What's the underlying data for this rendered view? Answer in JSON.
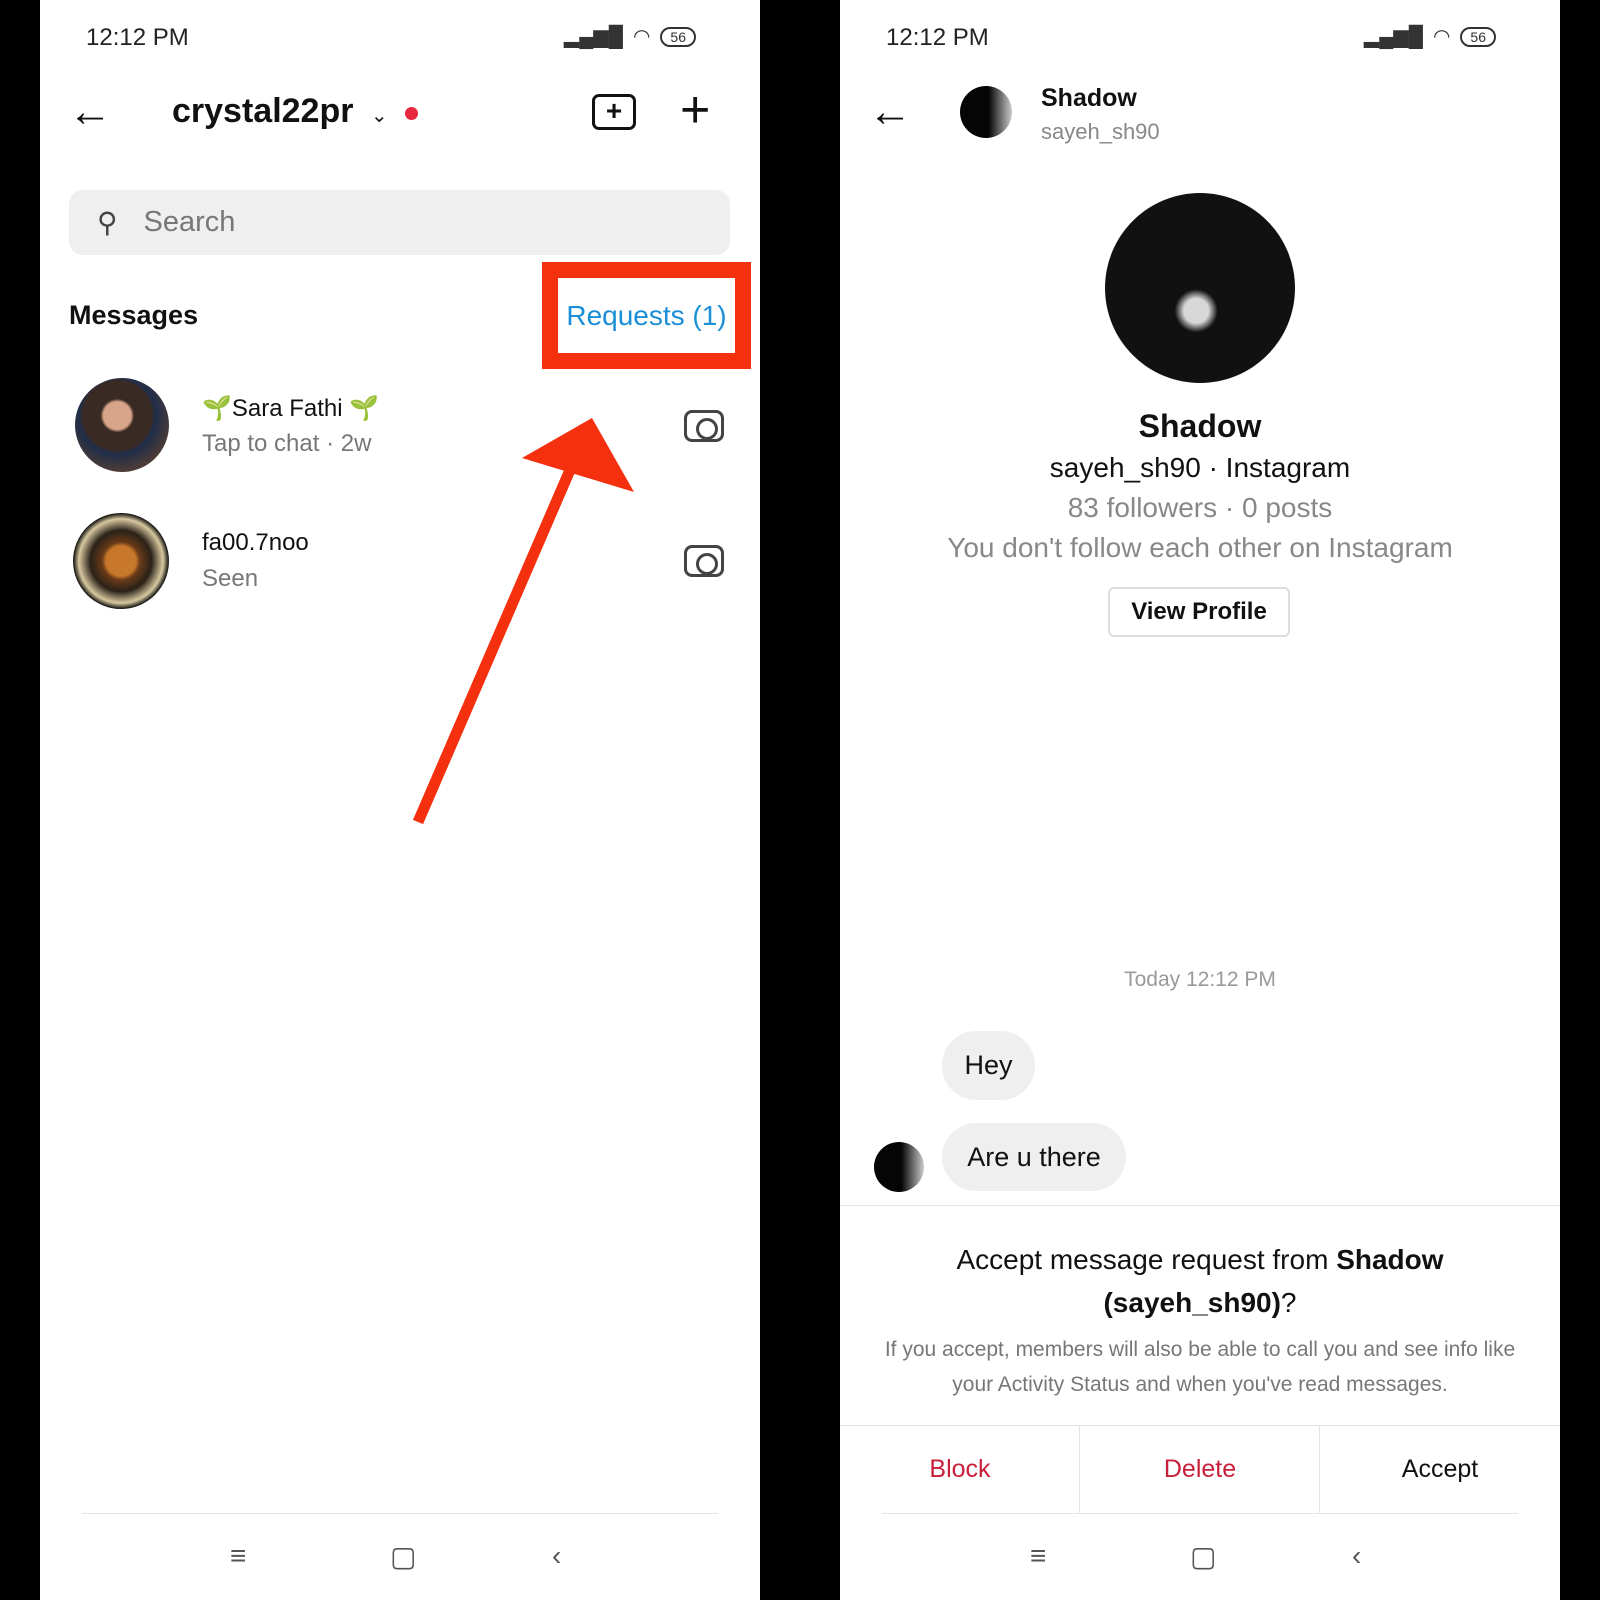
{
  "status_bar": {
    "time": "12:12 PM",
    "battery": "56"
  },
  "left": {
    "header": {
      "username": "crystal22pr"
    },
    "search": {
      "placeholder": "Search"
    },
    "section_title": "Messages",
    "requests_link": "Requests (1)",
    "conversations": [
      {
        "name": "🌱Sara Fathi 🌱",
        "subtitle": "Tap to chat · 2w"
      },
      {
        "name": "fa00.7noo",
        "subtitle": "Seen"
      }
    ]
  },
  "right": {
    "header": {
      "name": "Shadow",
      "username": "sayeh_sh90"
    },
    "profile": {
      "name": "Shadow",
      "handle_line": "sayeh_sh90 · Instagram",
      "stats": "83 followers · 0 posts",
      "relation": "You don't follow each other on Instagram",
      "view_profile": "View Profile"
    },
    "timestamp": "Today 12:12 PM",
    "messages": [
      "Hey",
      "Are u there"
    ],
    "request": {
      "prompt_prefix": "Accept message request from ",
      "prompt_bold": "Shadow (sayeh_sh90)",
      "prompt_suffix": "?",
      "description": "If you accept, members will also be able to call you and see info like your Activity Status and when you've read messages."
    },
    "actions": {
      "block": "Block",
      "delete": "Delete",
      "accept": "Accept"
    }
  },
  "colors": {
    "highlight": "#f5300f",
    "link": "#1a8fd8",
    "danger": "#c8203a",
    "online_dot": "#e8283e"
  }
}
